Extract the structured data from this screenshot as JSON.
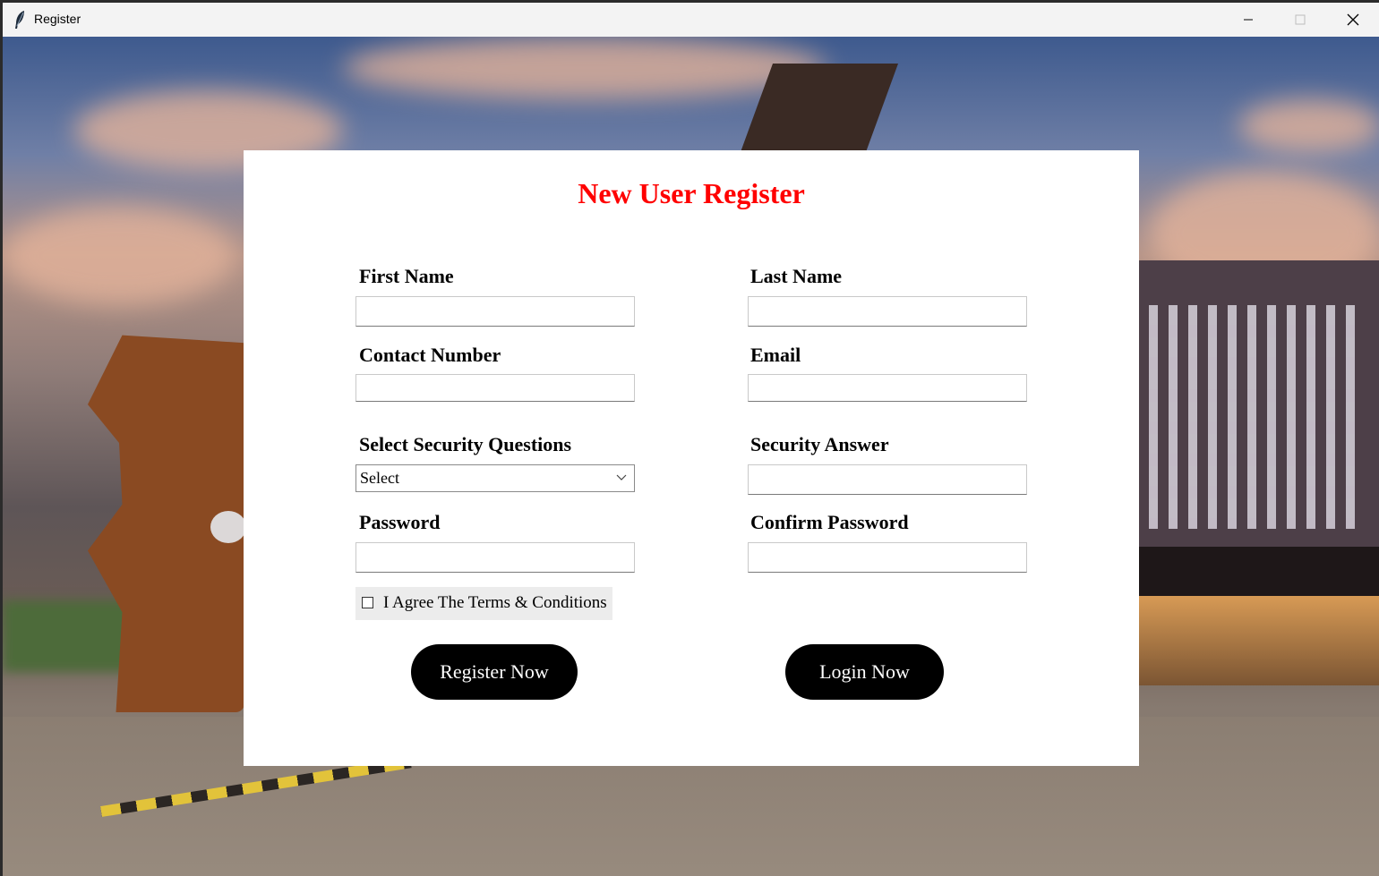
{
  "window": {
    "title": "Register",
    "controls": [
      "minimize",
      "maximize",
      "close"
    ]
  },
  "form": {
    "title": "New User Register",
    "title_color": "#ff0000",
    "fields": {
      "first_name": {
        "label": "First Name",
        "value": ""
      },
      "last_name": {
        "label": "Last Name",
        "value": ""
      },
      "contact": {
        "label": "Contact Number",
        "value": ""
      },
      "email": {
        "label": "Email",
        "value": ""
      },
      "security_question": {
        "label": "Select Security Questions",
        "selected": "Select"
      },
      "security_answer": {
        "label": "Security Answer",
        "value": ""
      },
      "password": {
        "label": "Password",
        "value": ""
      },
      "confirm_password": {
        "label": "Confirm Password",
        "value": ""
      }
    },
    "agree": {
      "label": "I Agree The Terms & Conditions",
      "checked": false
    },
    "buttons": {
      "register": "Register Now",
      "login": "Login Now"
    }
  }
}
